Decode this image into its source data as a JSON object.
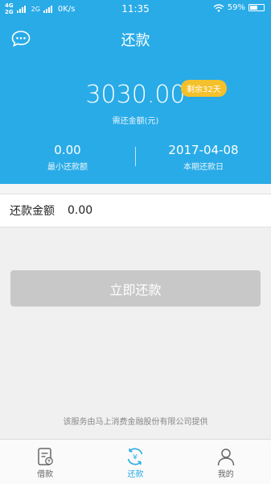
{
  "status_bar": {
    "network_1": "4G",
    "network_2": "2G",
    "network_3": "2G",
    "speed": "0K/s",
    "time": "11:35",
    "battery": "59%",
    "battery_level": 0.59
  },
  "header": {
    "title": "还款",
    "amount": "3030.00",
    "badge": "剩余32天",
    "amount_label": "需还金额(元)",
    "min_payment_value": "0.00",
    "min_payment_label": "最小还款额",
    "due_date_value": "2017-04-08",
    "due_date_label": "本期还款日"
  },
  "repay_row": {
    "label": "还款金额",
    "value": "0.00"
  },
  "submit_label": "立即还款",
  "footer_note": "该服务由马上消费金融股份有限公司提供",
  "tabs": [
    {
      "label": "借款",
      "icon": "loan-icon",
      "active": false
    },
    {
      "label": "还款",
      "icon": "repay-icon",
      "active": true
    },
    {
      "label": "我的",
      "icon": "user-icon",
      "active": false
    }
  ],
  "colors": {
    "brand": "#29abe7",
    "badge": "#f4c02b",
    "disabled_button": "#c8c8c8"
  }
}
